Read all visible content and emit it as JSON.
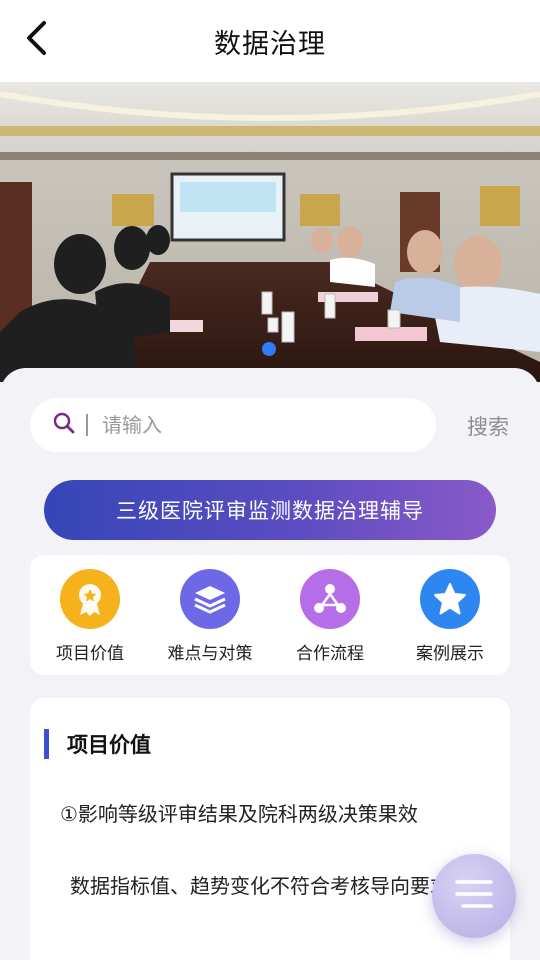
{
  "header": {
    "title": "数据治理"
  },
  "icons": {
    "back": "back-arrow-icon",
    "search": "search-icon",
    "menu": "hamburger-menu-icon"
  },
  "banner": {
    "description_icon": "meeting-photo"
  },
  "search": {
    "placeholder": "请输入",
    "button_label": "搜索"
  },
  "hero_button": {
    "label": "三级医院评审监测数据治理辅导"
  },
  "features": [
    {
      "label": "项目价值",
      "icon": "award-medal-icon",
      "color": "#f6b21c"
    },
    {
      "label": "难点与对策",
      "icon": "layers-icon",
      "color": "#6d69e6"
    },
    {
      "label": "合作流程",
      "icon": "share-nodes-icon",
      "color": "#b56ee8"
    },
    {
      "label": "案例展示",
      "icon": "star-icon",
      "color": "#2e86f0"
    }
  ],
  "section": {
    "title": "项目价值",
    "point1": "①影响等级评审结果及院科两级决策果效",
    "point2": "数据指标值、趋势变化不符合考核导向要求"
  },
  "colors": {
    "accent": "#3a4fd0",
    "carousel_dot": "#2f7df6"
  }
}
